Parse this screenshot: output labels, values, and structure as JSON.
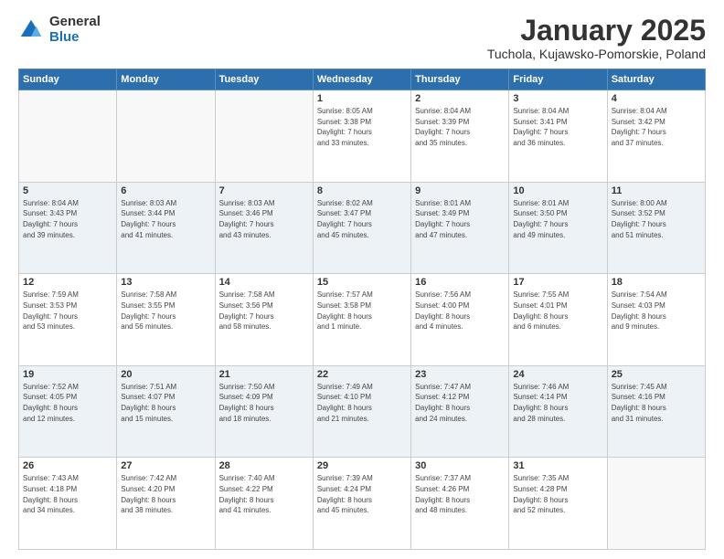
{
  "logo": {
    "general": "General",
    "blue": "Blue"
  },
  "header": {
    "month": "January 2025",
    "location": "Tuchola, Kujawsko-Pomorskie, Poland"
  },
  "weekdays": [
    "Sunday",
    "Monday",
    "Tuesday",
    "Wednesday",
    "Thursday",
    "Friday",
    "Saturday"
  ],
  "weeks": [
    [
      {
        "day": "",
        "info": ""
      },
      {
        "day": "",
        "info": ""
      },
      {
        "day": "",
        "info": ""
      },
      {
        "day": "1",
        "info": "Sunrise: 8:05 AM\nSunset: 3:38 PM\nDaylight: 7 hours\nand 33 minutes."
      },
      {
        "day": "2",
        "info": "Sunrise: 8:04 AM\nSunset: 3:39 PM\nDaylight: 7 hours\nand 35 minutes."
      },
      {
        "day": "3",
        "info": "Sunrise: 8:04 AM\nSunset: 3:41 PM\nDaylight: 7 hours\nand 36 minutes."
      },
      {
        "day": "4",
        "info": "Sunrise: 8:04 AM\nSunset: 3:42 PM\nDaylight: 7 hours\nand 37 minutes."
      }
    ],
    [
      {
        "day": "5",
        "info": "Sunrise: 8:04 AM\nSunset: 3:43 PM\nDaylight: 7 hours\nand 39 minutes."
      },
      {
        "day": "6",
        "info": "Sunrise: 8:03 AM\nSunset: 3:44 PM\nDaylight: 7 hours\nand 41 minutes."
      },
      {
        "day": "7",
        "info": "Sunrise: 8:03 AM\nSunset: 3:46 PM\nDaylight: 7 hours\nand 43 minutes."
      },
      {
        "day": "8",
        "info": "Sunrise: 8:02 AM\nSunset: 3:47 PM\nDaylight: 7 hours\nand 45 minutes."
      },
      {
        "day": "9",
        "info": "Sunrise: 8:01 AM\nSunset: 3:49 PM\nDaylight: 7 hours\nand 47 minutes."
      },
      {
        "day": "10",
        "info": "Sunrise: 8:01 AM\nSunset: 3:50 PM\nDaylight: 7 hours\nand 49 minutes."
      },
      {
        "day": "11",
        "info": "Sunrise: 8:00 AM\nSunset: 3:52 PM\nDaylight: 7 hours\nand 51 minutes."
      }
    ],
    [
      {
        "day": "12",
        "info": "Sunrise: 7:59 AM\nSunset: 3:53 PM\nDaylight: 7 hours\nand 53 minutes."
      },
      {
        "day": "13",
        "info": "Sunrise: 7:58 AM\nSunset: 3:55 PM\nDaylight: 7 hours\nand 56 minutes."
      },
      {
        "day": "14",
        "info": "Sunrise: 7:58 AM\nSunset: 3:56 PM\nDaylight: 7 hours\nand 58 minutes."
      },
      {
        "day": "15",
        "info": "Sunrise: 7:57 AM\nSunset: 3:58 PM\nDaylight: 8 hours\nand 1 minute."
      },
      {
        "day": "16",
        "info": "Sunrise: 7:56 AM\nSunset: 4:00 PM\nDaylight: 8 hours\nand 4 minutes."
      },
      {
        "day": "17",
        "info": "Sunrise: 7:55 AM\nSunset: 4:01 PM\nDaylight: 8 hours\nand 6 minutes."
      },
      {
        "day": "18",
        "info": "Sunrise: 7:54 AM\nSunset: 4:03 PM\nDaylight: 8 hours\nand 9 minutes."
      }
    ],
    [
      {
        "day": "19",
        "info": "Sunrise: 7:52 AM\nSunset: 4:05 PM\nDaylight: 8 hours\nand 12 minutes."
      },
      {
        "day": "20",
        "info": "Sunrise: 7:51 AM\nSunset: 4:07 PM\nDaylight: 8 hours\nand 15 minutes."
      },
      {
        "day": "21",
        "info": "Sunrise: 7:50 AM\nSunset: 4:09 PM\nDaylight: 8 hours\nand 18 minutes."
      },
      {
        "day": "22",
        "info": "Sunrise: 7:49 AM\nSunset: 4:10 PM\nDaylight: 8 hours\nand 21 minutes."
      },
      {
        "day": "23",
        "info": "Sunrise: 7:47 AM\nSunset: 4:12 PM\nDaylight: 8 hours\nand 24 minutes."
      },
      {
        "day": "24",
        "info": "Sunrise: 7:46 AM\nSunset: 4:14 PM\nDaylight: 8 hours\nand 28 minutes."
      },
      {
        "day": "25",
        "info": "Sunrise: 7:45 AM\nSunset: 4:16 PM\nDaylight: 8 hours\nand 31 minutes."
      }
    ],
    [
      {
        "day": "26",
        "info": "Sunrise: 7:43 AM\nSunset: 4:18 PM\nDaylight: 8 hours\nand 34 minutes."
      },
      {
        "day": "27",
        "info": "Sunrise: 7:42 AM\nSunset: 4:20 PM\nDaylight: 8 hours\nand 38 minutes."
      },
      {
        "day": "28",
        "info": "Sunrise: 7:40 AM\nSunset: 4:22 PM\nDaylight: 8 hours\nand 41 minutes."
      },
      {
        "day": "29",
        "info": "Sunrise: 7:39 AM\nSunset: 4:24 PM\nDaylight: 8 hours\nand 45 minutes."
      },
      {
        "day": "30",
        "info": "Sunrise: 7:37 AM\nSunset: 4:26 PM\nDaylight: 8 hours\nand 48 minutes."
      },
      {
        "day": "31",
        "info": "Sunrise: 7:35 AM\nSunset: 4:28 PM\nDaylight: 8 hours\nand 52 minutes."
      },
      {
        "day": "",
        "info": ""
      }
    ]
  ]
}
